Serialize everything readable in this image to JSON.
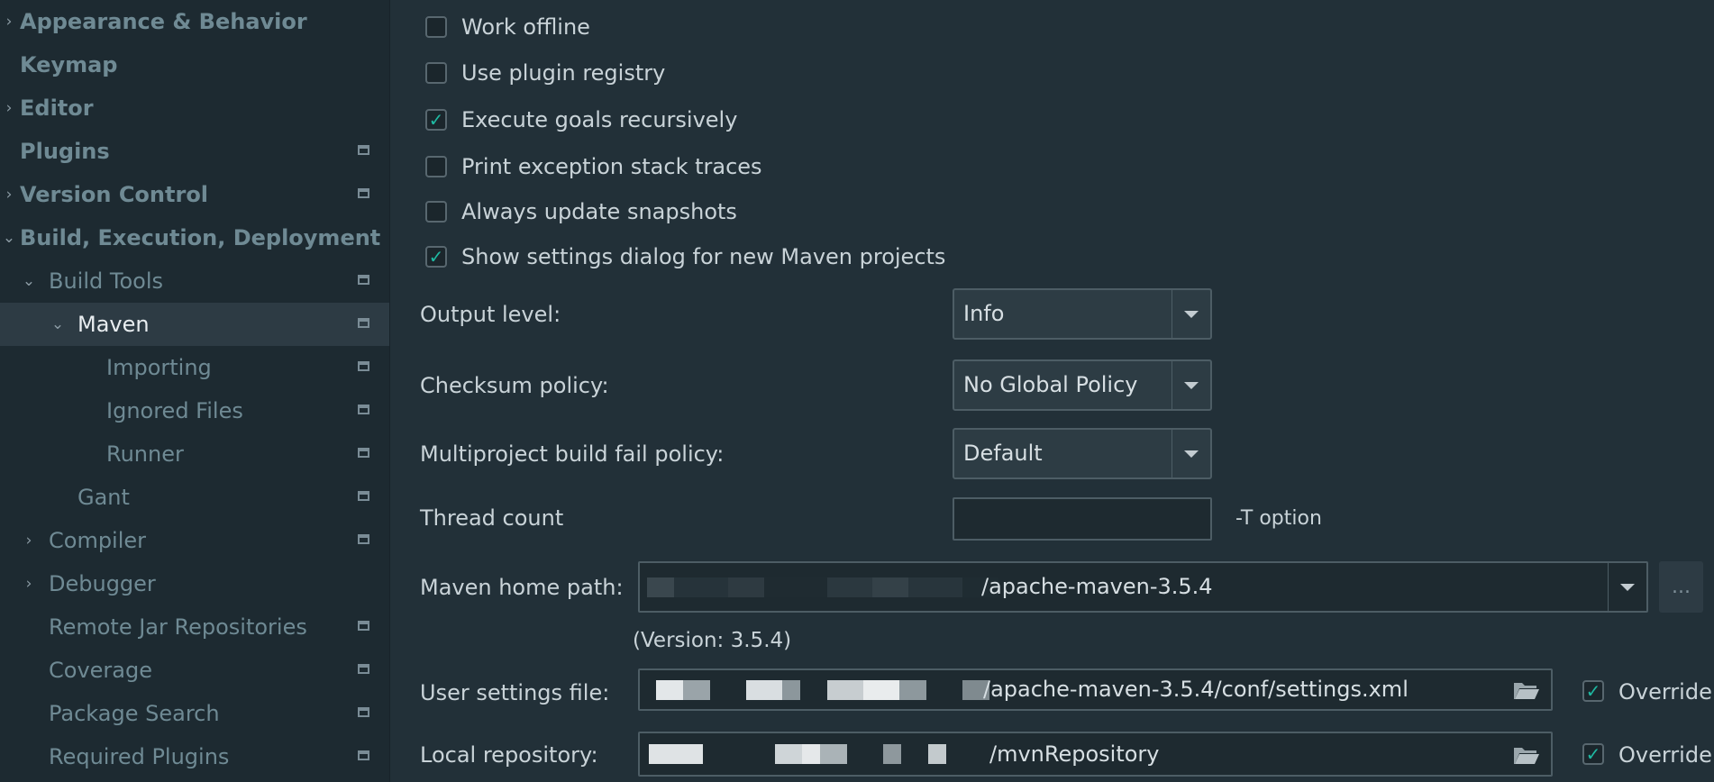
{
  "sidebar": {
    "items": [
      {
        "label": "Appearance & Behavior",
        "arrow": "›",
        "bold": true,
        "icon": false
      },
      {
        "label": "Keymap",
        "arrow": "",
        "bold": true,
        "icon": false
      },
      {
        "label": "Editor",
        "arrow": "›",
        "bold": true,
        "icon": false
      },
      {
        "label": "Plugins",
        "arrow": "",
        "bold": true,
        "icon": true
      },
      {
        "label": "Version Control",
        "arrow": "›",
        "bold": true,
        "icon": true
      },
      {
        "label": "Build, Execution, Deployment",
        "arrow": "⌄",
        "bold": true,
        "icon": false
      },
      {
        "label": "Build Tools",
        "arrow": "⌄",
        "bold": false,
        "icon": true
      },
      {
        "label": "Maven",
        "arrow": "⌄",
        "bold": false,
        "icon": true,
        "selected": true
      },
      {
        "label": "Importing",
        "arrow": "",
        "bold": false,
        "icon": true
      },
      {
        "label": "Ignored Files",
        "arrow": "",
        "bold": false,
        "icon": true
      },
      {
        "label": "Runner",
        "arrow": "",
        "bold": false,
        "icon": true
      },
      {
        "label": "Gant",
        "arrow": "",
        "bold": false,
        "icon": true
      },
      {
        "label": "Compiler",
        "arrow": "›",
        "bold": false,
        "icon": true
      },
      {
        "label": "Debugger",
        "arrow": "›",
        "bold": false,
        "icon": false
      },
      {
        "label": "Remote Jar Repositories",
        "arrow": "",
        "bold": false,
        "icon": true
      },
      {
        "label": "Coverage",
        "arrow": "",
        "bold": false,
        "icon": true
      },
      {
        "label": "Package Search",
        "arrow": "",
        "bold": false,
        "icon": true
      },
      {
        "label": "Required Plugins",
        "arrow": "",
        "bold": false,
        "icon": true
      }
    ]
  },
  "options": {
    "work_offline": {
      "label": "Work offline",
      "checked": false
    },
    "use_plugin_registry": {
      "label": "Use plugin registry",
      "checked": false
    },
    "execute_goals_recursively": {
      "label": "Execute goals recursively",
      "checked": true
    },
    "print_exception_stack_traces": {
      "label": "Print exception stack traces",
      "checked": false
    },
    "always_update_snapshots": {
      "label": "Always update snapshots",
      "checked": false
    },
    "show_settings_dialog": {
      "label": "Show settings dialog for new Maven projects",
      "checked": true
    }
  },
  "output_level": {
    "label": "Output level:",
    "value": "Info"
  },
  "checksum_policy": {
    "label": "Checksum policy:",
    "value": "No Global Policy"
  },
  "multiproject_policy": {
    "label": "Multiproject build fail policy:",
    "value": "Default"
  },
  "thread_count": {
    "label": "Thread count",
    "value": "",
    "hint": "-T option"
  },
  "maven_home": {
    "label": "Maven home path:",
    "value": "/apache-maven-3.5.4",
    "browse": "...",
    "version": "(Version: 3.5.4)"
  },
  "user_settings": {
    "label": "User settings file:",
    "value": "/apache-maven-3.5.4/conf/settings.xml",
    "override_label": "Override",
    "override_checked": true
  },
  "local_repository": {
    "label": "Local repository:",
    "value": "/mvnRepository",
    "override_label": "Override",
    "override_checked": true
  },
  "colors": {
    "accent_check": "#1fb9a2",
    "sidebar_bg": "#1d2a31",
    "main_bg": "#223038",
    "selected_bg": "#2d3b44"
  },
  "icons": {
    "check": "✓",
    "folder": "folder-icon",
    "project": "project-level-icon"
  }
}
